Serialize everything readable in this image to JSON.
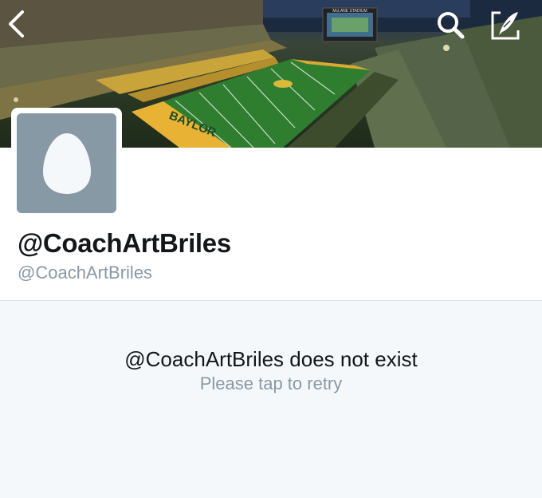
{
  "profile": {
    "display_name": "@CoachArtBriles",
    "screen_name": "@CoachArtBriles"
  },
  "banner": {
    "image": "stadium-photo",
    "endzone_text": "BAYLOR",
    "scoreboard_text": "McLANE STADIUM"
  },
  "icons": {
    "back": "chevron-left-icon",
    "search": "search-icon",
    "compose": "compose-icon"
  },
  "error": {
    "title": "@CoachArtBriles does not exist",
    "subtitle": "Please tap to retry"
  },
  "colors": {
    "avatar_bg": "#8899a6",
    "muted_text": "#8899a6",
    "panel_bg": "#f5f8fa",
    "field_green": "#2f7d2f",
    "endzone_gold": "#e8b234"
  }
}
